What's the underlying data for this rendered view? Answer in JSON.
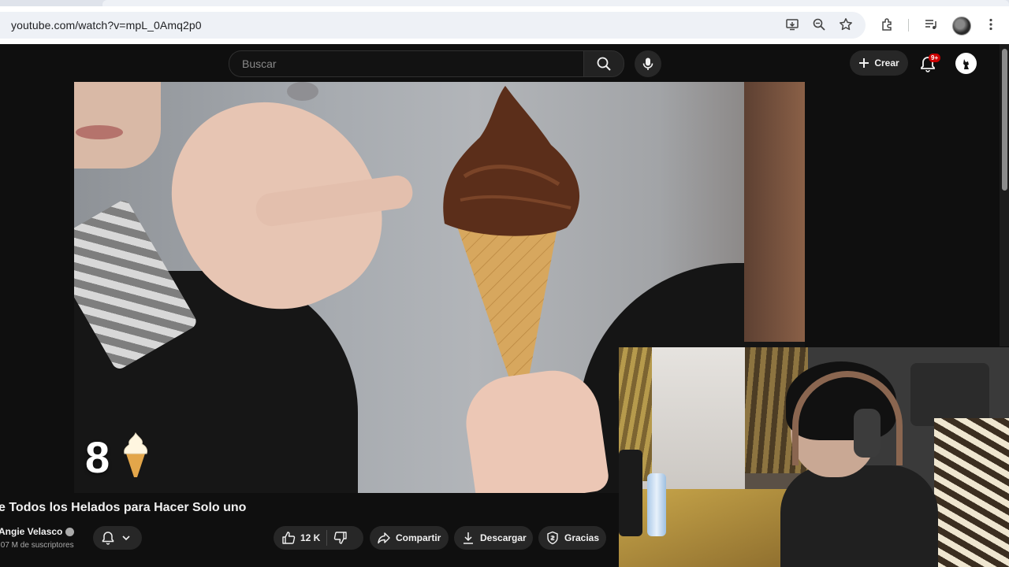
{
  "browser": {
    "url": "youtube.com/watch?v=mpL_0Amq2p0",
    "toolbar_icons": [
      "install-app-icon",
      "zoom-icon",
      "bookmark-star-icon",
      "extensions-icon",
      "media-controls-icon",
      "profile-avatar",
      "more-menu-icon"
    ]
  },
  "header": {
    "search_placeholder": "Buscar",
    "create_label": "Crear",
    "notification_badge": "9+"
  },
  "video": {
    "overlay_number": "8",
    "overlay_emoji_icon": "soft-serve-ice-cream-icon"
  },
  "meta": {
    "title": "e Todos los Helados para Hacer Solo uno",
    "channel": "Angie Velasco",
    "subscribers": ",07 M de suscriptores",
    "like_count": "12 K",
    "share_label": "Compartir",
    "download_label": "Descargar",
    "thanks_label": "Gracias"
  },
  "colors": {
    "youtube_bg": "#0f0f0f",
    "pill_bg": "#272727",
    "notification_red": "#cc0000"
  }
}
